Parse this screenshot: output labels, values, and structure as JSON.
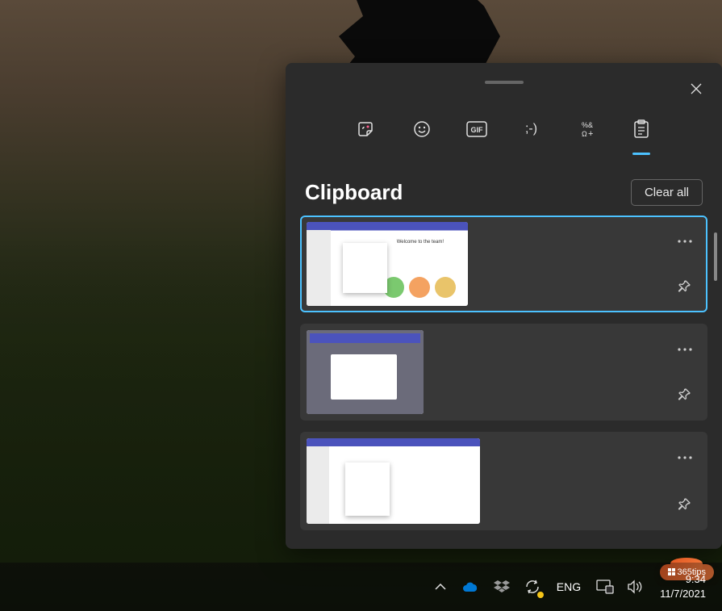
{
  "panel": {
    "title": "Clipboard",
    "clear_all_label": "Clear all",
    "tabs": [
      {
        "name": "stickers",
        "icon": "sticker"
      },
      {
        "name": "emoji",
        "icon": "smile"
      },
      {
        "name": "gif",
        "icon": "gif"
      },
      {
        "name": "kaomoji",
        "icon": "kaomoji"
      },
      {
        "name": "symbols",
        "icon": "symbols"
      },
      {
        "name": "clipboard",
        "icon": "clipboard",
        "active": true
      }
    ],
    "items": [
      {
        "type": "image",
        "desc": "Microsoft Teams welcome screen",
        "selected": true
      },
      {
        "type": "image",
        "desc": "Dialog box screenshot",
        "selected": false
      },
      {
        "type": "image",
        "desc": "Microsoft Teams files view",
        "selected": false
      }
    ]
  },
  "taskbar": {
    "language": "ENG",
    "time": "9:34",
    "date": "11/7/2021"
  },
  "watermark": {
    "text": "365tips"
  }
}
